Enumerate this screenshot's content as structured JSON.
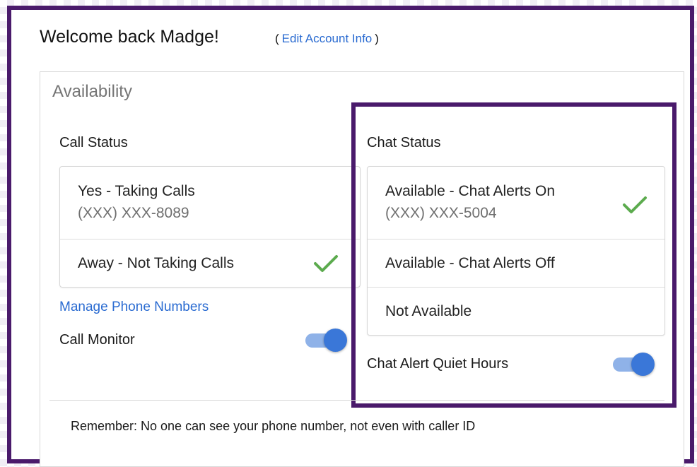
{
  "header": {
    "welcome": "Welcome back Madge!",
    "edit_open": "(",
    "edit_link": "Edit Account Info",
    "edit_close": ")"
  },
  "availability": {
    "title": "Availability"
  },
  "call": {
    "title": "Call Status",
    "options": [
      {
        "label": "Yes - Taking Calls",
        "sub": "(XXX) XXX-8089",
        "selected": false
      },
      {
        "label": "Away - Not Taking Calls",
        "selected": true
      }
    ],
    "manage_link": "Manage Phone Numbers",
    "monitor_label": "Call Monitor",
    "monitor_on": true
  },
  "chat": {
    "title": "Chat Status",
    "options": [
      {
        "label": "Available - Chat Alerts On",
        "sub": "(XXX) XXX-5004",
        "selected": true
      },
      {
        "label": "Available - Chat Alerts Off",
        "selected": false
      },
      {
        "label": "Not Available",
        "selected": false
      }
    ],
    "quiet_label": "Chat Alert Quiet Hours",
    "quiet_on": true
  },
  "footer": {
    "remember": "Remember: No one can see your phone number, not even with caller ID"
  },
  "colors": {
    "accent_purple": "#4a1a6b",
    "link_blue": "#2a6bd1",
    "check_green": "#5cab4e",
    "toggle_knob": "#3a77d8",
    "toggle_track": "#8fb2e8"
  }
}
